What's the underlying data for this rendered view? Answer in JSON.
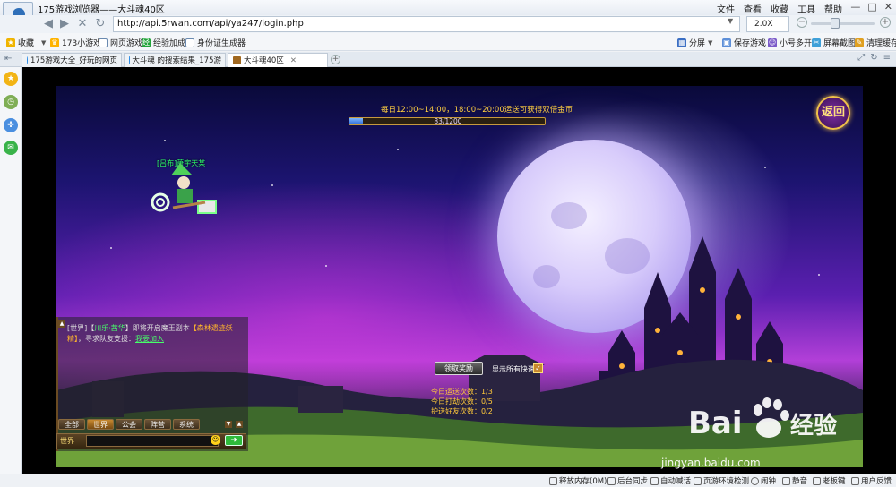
{
  "window": {
    "title": "175游戏浏览器——大斗魂40区",
    "menu": [
      "文件",
      "查看",
      "收藏",
      "工具",
      "帮助"
    ],
    "controls": [
      "—",
      "□",
      "✕"
    ]
  },
  "address": {
    "url": "http://api.5rwan.com/api/ya247/login.php",
    "zoom": "2.0X"
  },
  "bookmarks": {
    "left": [
      "收藏",
      "173小游戏",
      "网页游戏",
      "经验加成",
      "身份证生成器"
    ],
    "right": [
      "分屏",
      "保存游戏",
      "小号多开",
      "屏幕截图",
      "清理缓存"
    ]
  },
  "tabs": [
    {
      "label": "175游戏大全_好玩的网页",
      "active": false
    },
    {
      "label": "大斗魂 的搜索结果_175游",
      "active": false
    },
    {
      "label": "大斗魂40区",
      "active": true
    }
  ],
  "game": {
    "banner": "每日12:00~14:00，18:00~20:00运送可获得双倍金币",
    "progress_text": "83/1200",
    "progress_value": 83,
    "progress_max": 1200,
    "back_label": "返回",
    "player_name": "[吕布]萧宇天某",
    "chat": {
      "parts": [
        {
          "t": "[世界]",
          "c": "c-w"
        },
        {
          "t": "【",
          "c": "c-w"
        },
        {
          "t": "川乐·茜华",
          "c": "c-g"
        },
        {
          "t": "】即将开启魔王副本",
          "c": "c-w"
        },
        {
          "t": "【森林遗迹妖精】",
          "c": "c-o"
        },
        {
          "t": "，寻求队友支援：",
          "c": "c-w"
        },
        {
          "t": "我要加入",
          "c": "c-u"
        }
      ],
      "tabs": [
        "全部",
        "世界",
        "公会",
        "阵营",
        "系统"
      ],
      "active_tab": 1,
      "channel": "世界",
      "send": "➜"
    },
    "claim_label": "领取奖励",
    "show_all_label": "显示所有快递",
    "stats": [
      "今日运送次数：1/3",
      "今日打劫次数：0/5",
      "护送好友次数：0/2"
    ]
  },
  "watermark": {
    "text": "jingyan.baidu.com"
  },
  "status": [
    "释放内存(0M)",
    "后台同步",
    "自动喊话",
    "页游环境检测",
    "闹钟",
    "静音",
    "老板键",
    "用户反馈"
  ]
}
